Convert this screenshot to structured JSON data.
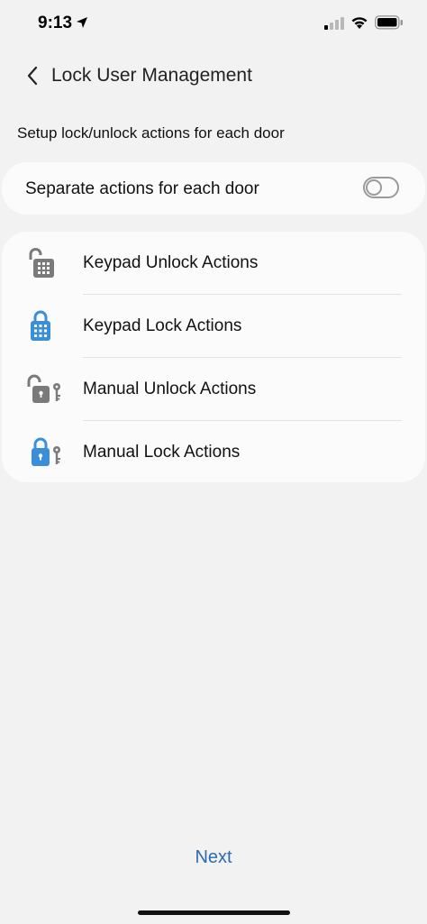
{
  "status_bar": {
    "time": "9:13",
    "icons": [
      "location-arrow-icon",
      "cellular-signal-icon",
      "wifi-icon",
      "battery-icon"
    ]
  },
  "header": {
    "back_icon": "chevron-left-icon",
    "title": "Lock User Management"
  },
  "section_caption": "Setup lock/unlock actions for each door",
  "separate_toggle": {
    "label": "Separate actions for each door",
    "state": "off"
  },
  "actions": [
    {
      "label": "Keypad Unlock Actions",
      "icon": "keypad-unlocked-icon",
      "icon_color": "#7a7a7a"
    },
    {
      "label": "Keypad Lock Actions",
      "icon": "keypad-locked-icon",
      "icon_color": "#3b8fd9"
    },
    {
      "label": "Manual Unlock Actions",
      "icon": "key-unlocked-icon",
      "icon_color": "#7a7a7a"
    },
    {
      "label": "Manual Lock Actions",
      "icon": "key-locked-icon",
      "icon_color": "#3b8fd9"
    }
  ],
  "footer": {
    "next_label": "Next"
  },
  "colors": {
    "background": "#f2f2f2",
    "card": "#fbfbfb",
    "accent": "#2b6cb0",
    "lock_blue": "#3b8fd9",
    "lock_gray": "#7a7a7a"
  }
}
